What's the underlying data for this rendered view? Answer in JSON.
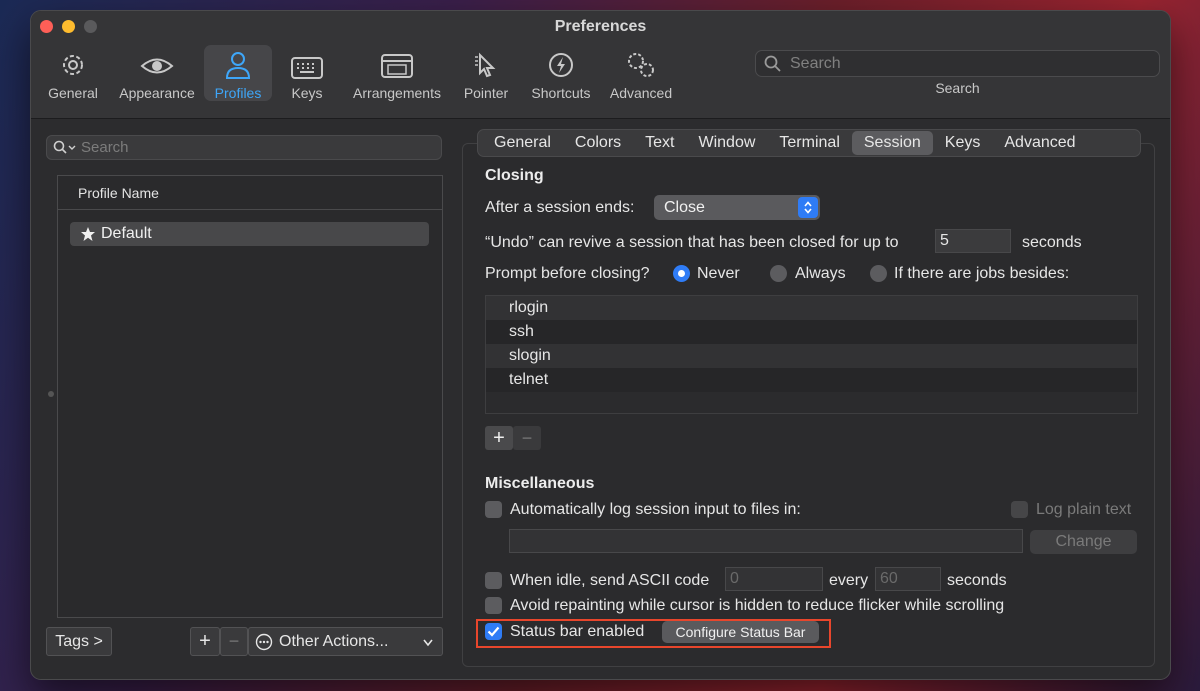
{
  "window": {
    "title": "Preferences"
  },
  "toolbar": {
    "items": [
      {
        "label": "General",
        "icon": "gear-icon"
      },
      {
        "label": "Appearance",
        "icon": "eye-icon"
      },
      {
        "label": "Profiles",
        "icon": "person-icon",
        "active": true
      },
      {
        "label": "Keys",
        "icon": "keyboard-icon"
      },
      {
        "label": "Arrangements",
        "icon": "windows-icon"
      },
      {
        "label": "Pointer",
        "icon": "pointer-icon"
      },
      {
        "label": "Shortcuts",
        "icon": "lightning-icon"
      },
      {
        "label": "Advanced",
        "icon": "gears-icon"
      }
    ],
    "search_placeholder": "Search",
    "search_label": "Search"
  },
  "profiles": {
    "search_placeholder": "Search",
    "column_header": "Profile Name",
    "items": [
      {
        "name": "Default",
        "is_default": true
      }
    ],
    "tags_button": "Tags >",
    "add_label": "+",
    "remove_label": "−",
    "other_actions": "Other Actions..."
  },
  "tabs": [
    "General",
    "Colors",
    "Text",
    "Window",
    "Terminal",
    "Session",
    "Keys",
    "Advanced"
  ],
  "active_tab": "Session",
  "closing": {
    "heading": "Closing",
    "after_session_label": "After a session ends:",
    "after_session_value": "Close",
    "undo_label": "“Undo” can revive a session that has been closed for up to",
    "undo_value": "5",
    "undo_unit": "seconds",
    "prompt_label": "Prompt before closing?",
    "prompt_options": [
      "Never",
      "Always",
      "If there are jobs besides:"
    ],
    "prompt_selected": "Never",
    "jobs": [
      "rlogin",
      "ssh",
      "slogin",
      "telnet"
    ],
    "add_label": "+",
    "remove_label": "−"
  },
  "misc": {
    "heading": "Miscellaneous",
    "log_label": "Automatically log session input to files in:",
    "log_plain_label": "Log plain text",
    "change_button": "Change",
    "idle_label": "When idle, send ASCII code",
    "idle_code": "0",
    "every_label": "every",
    "idle_seconds": "60",
    "seconds_label": "seconds",
    "avoid_label": "Avoid repainting while cursor is hidden to reduce flicker while scrolling",
    "status_bar_label": "Status bar enabled",
    "status_bar_checked": true,
    "configure_button": "Configure Status Bar"
  },
  "colors": {
    "accent": "#2f7cf6",
    "active_toolbar": "#3ea6f8",
    "highlight_box": "#e8462c"
  }
}
